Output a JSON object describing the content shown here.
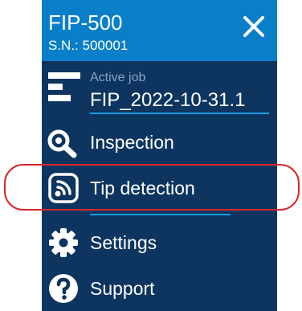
{
  "device": {
    "name": "FIP-500",
    "serial": "S.N.: 500001"
  },
  "active_job": {
    "caption": "Active job",
    "value": "FIP_2022-10-31.1"
  },
  "menu": [
    {
      "label": "Inspection",
      "icon": "magnifier-icon"
    },
    {
      "label": "Tip detection",
      "icon": "tip-detection-icon",
      "highlighted": true
    },
    {
      "label": "Settings",
      "icon": "gear-icon"
    },
    {
      "label": "Support",
      "icon": "help-icon"
    }
  ],
  "colors": {
    "panel": "#0d3560",
    "header": "#0a7fc9",
    "accent": "#1e9ae0",
    "highlight_outline": "#d9262b"
  }
}
